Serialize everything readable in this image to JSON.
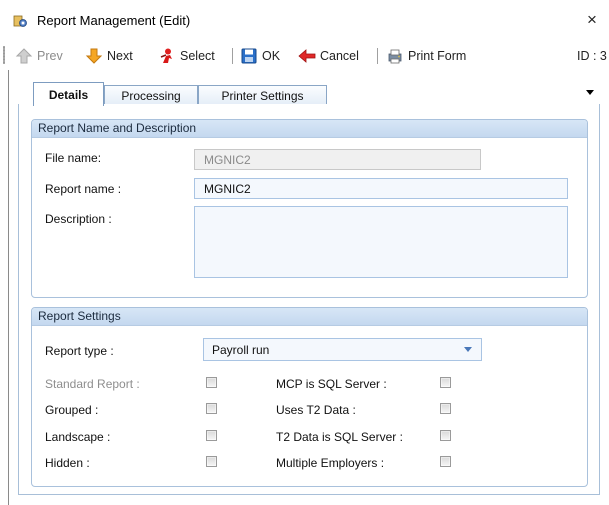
{
  "window": {
    "title": "Report Management (Edit)",
    "close_glyph": "×"
  },
  "toolbar": {
    "prev_label": "Prev",
    "next_label": "Next",
    "select_label": "Select",
    "ok_label": "OK",
    "cancel_label": "Cancel",
    "print_label": "Print Form",
    "id_label": "ID : 3"
  },
  "tabs": [
    {
      "label": "Details",
      "active": true
    },
    {
      "label": "Processing",
      "active": false
    },
    {
      "label": "Printer Settings",
      "active": false
    }
  ],
  "name_desc": {
    "header": "Report Name and Description",
    "file_name_label": "File name:",
    "file_name_value": "MGNIC2",
    "report_name_label": "Report name :",
    "report_name_value": "MGNIC2",
    "description_label": "Description :",
    "description_value": ""
  },
  "settings": {
    "header": "Report Settings",
    "report_type_label": "Report type :",
    "report_type_value": "Payroll run",
    "checkboxes_left": [
      {
        "label": "Standard Report :",
        "checked": false,
        "disabled": true
      },
      {
        "label": "Grouped :",
        "checked": false,
        "disabled": false
      },
      {
        "label": "Landscape :",
        "checked": false,
        "disabled": false
      },
      {
        "label": "Hidden :",
        "checked": false,
        "disabled": false
      }
    ],
    "checkboxes_right": [
      {
        "label": "MCP is SQL Server :",
        "checked": false
      },
      {
        "label": "Uses T2 Data :",
        "checked": false
      },
      {
        "label": "T2 Data is SQL Server :",
        "checked": false
      },
      {
        "label": "Multiple Employers :",
        "checked": false
      }
    ]
  },
  "colors": {
    "group_header": "#c9dcf1",
    "tab_border": "#8aa6c6",
    "field_border": "#a9c4e3"
  },
  "icons": [
    "app-icon",
    "up-arrow-icon",
    "down-arrow-icon",
    "select-person-icon",
    "save-disk-icon",
    "back-arrow-icon",
    "print-form-icon",
    "close-icon"
  ]
}
